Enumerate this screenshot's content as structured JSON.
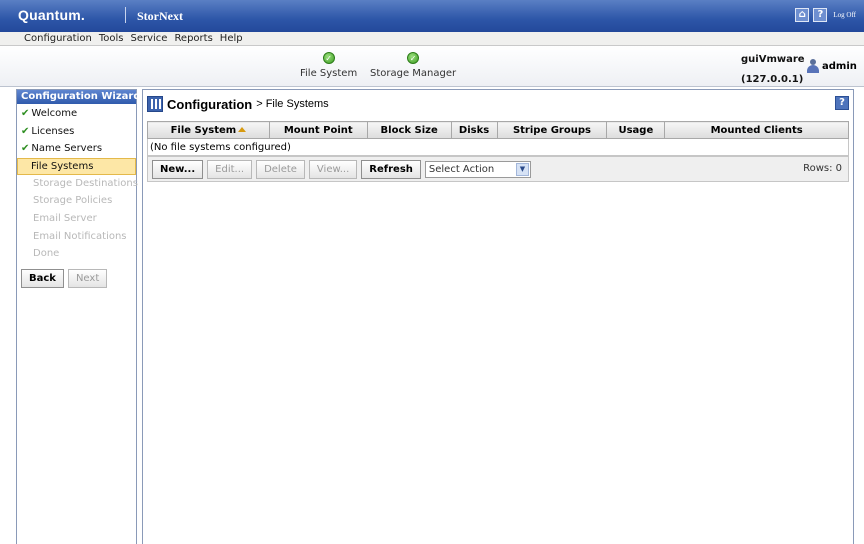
{
  "header": {
    "brand": "Quantum.",
    "product": "StorNext",
    "logoff": "Log Off"
  },
  "menu": [
    "Configuration",
    "Tools",
    "Service",
    "Reports",
    "Help"
  ],
  "status": {
    "file_system": "File System",
    "storage_manager": "Storage Manager",
    "host_name": "guiVmware",
    "host_ip": "(127.0.0.1)",
    "user": "admin"
  },
  "wizard": {
    "title": "Configuration Wizard",
    "steps": [
      {
        "label": "Welcome",
        "state": "done"
      },
      {
        "label": "Licenses",
        "state": "done"
      },
      {
        "label": "Name Servers",
        "state": "done"
      },
      {
        "label": "File Systems",
        "state": "active"
      },
      {
        "label": "Storage Destinations",
        "state": "disabled"
      },
      {
        "label": "Storage Policies",
        "state": "disabled"
      },
      {
        "label": "Email Server",
        "state": "disabled"
      },
      {
        "label": "Email Notifications",
        "state": "disabled"
      },
      {
        "label": "Done",
        "state": "disabled"
      }
    ],
    "back_label": "Back",
    "next_label": "Next"
  },
  "main": {
    "title": "Configuration",
    "crumb": "> File Systems",
    "columns": [
      "File System",
      "Mount Point",
      "Block Size",
      "Disks",
      "Stripe Groups",
      "Usage",
      "Mounted Clients"
    ],
    "empty_message": "(No file systems configured)",
    "actions": {
      "new": "New...",
      "edit": "Edit...",
      "delete": "Delete",
      "view": "View...",
      "refresh": "Refresh",
      "select_action": "Select Action",
      "rows": "Rows: 0"
    }
  },
  "colors": {
    "title_bar": "#2d56a8",
    "active_step": "#fde7a6",
    "check": "#2f8f22"
  }
}
